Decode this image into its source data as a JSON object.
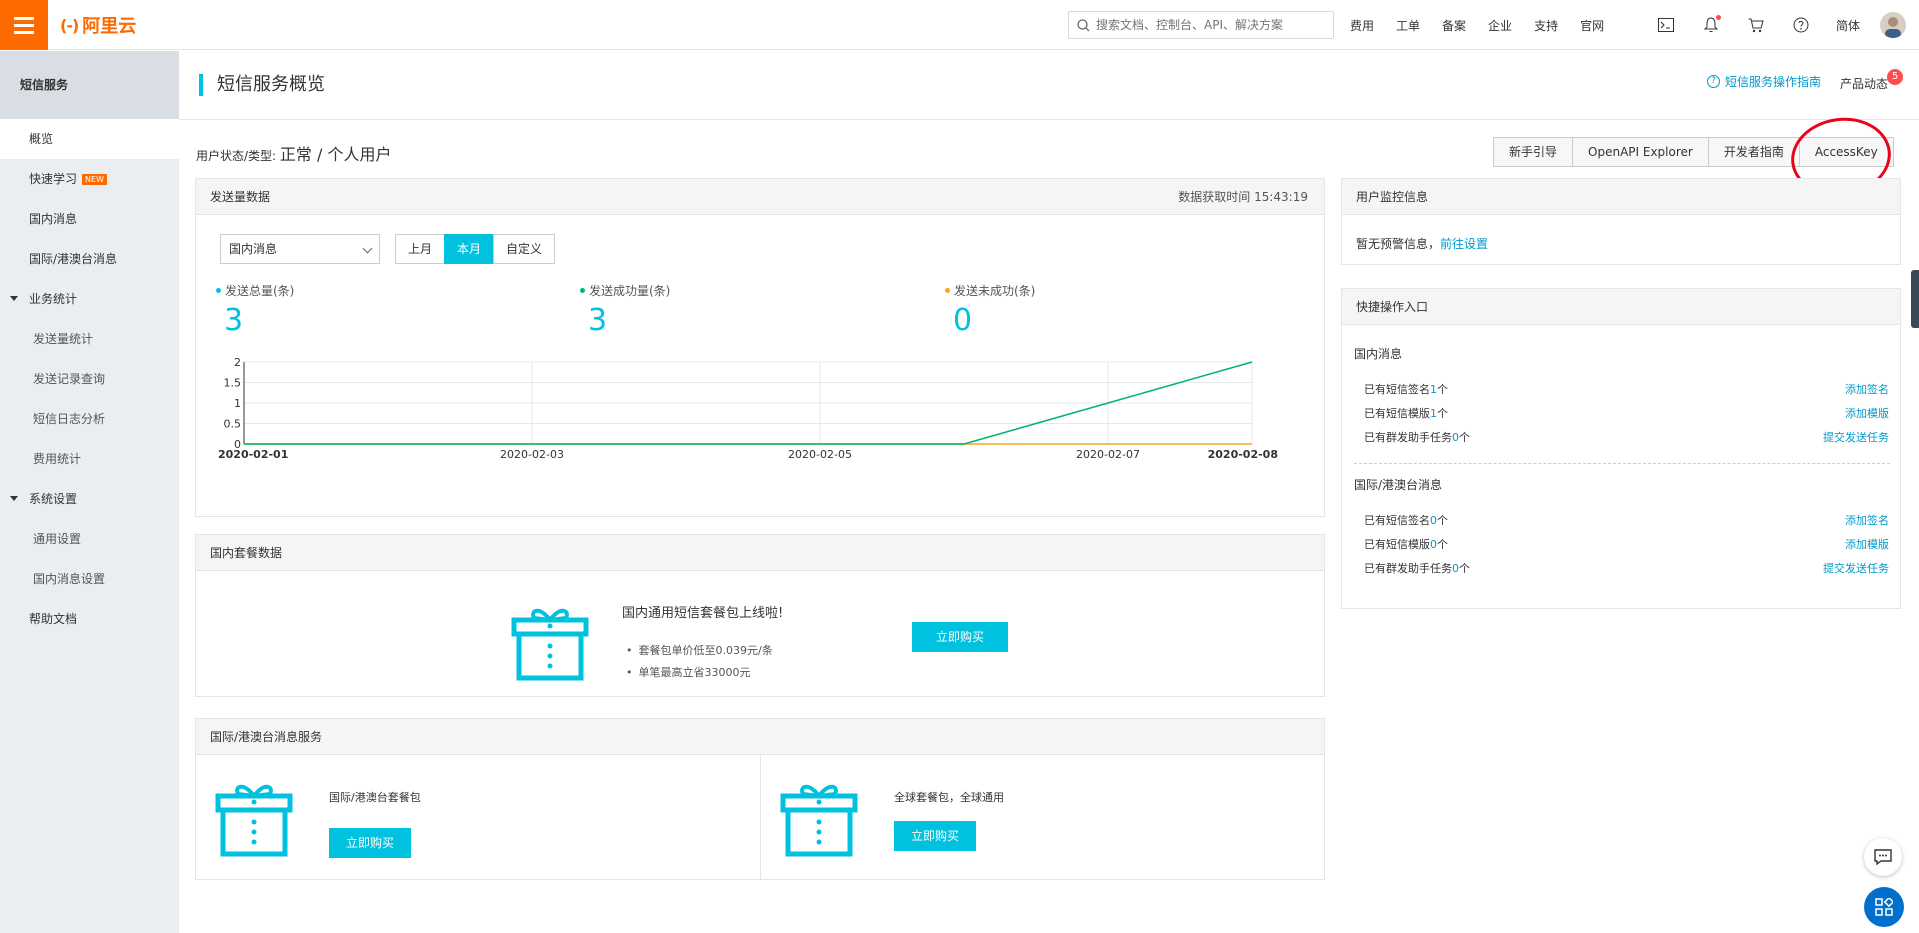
{
  "topbar": {
    "logo_text": "阿里云",
    "logo_mark": "(-)",
    "search_placeholder": "搜索文档、控制台、API、解决方案",
    "links": [
      "费用",
      "工单",
      "备案",
      "企业",
      "支持",
      "官网"
    ],
    "lang": "简体",
    "icons": [
      "terminal-icon",
      "bell-icon",
      "cart-icon",
      "help-icon"
    ]
  },
  "sidebar": {
    "title": "短信服务",
    "items": [
      {
        "label": "概览",
        "active": true
      },
      {
        "label": "快速学习",
        "badge": "NEW"
      },
      {
        "label": "国内消息"
      },
      {
        "label": "国际/港澳台消息"
      },
      {
        "label": "业务统计",
        "group": true
      },
      {
        "label": "发送量统计",
        "sub": true
      },
      {
        "label": "发送记录查询",
        "sub": true
      },
      {
        "label": "短信日志分析",
        "sub": true
      },
      {
        "label": "费用统计",
        "sub": true
      },
      {
        "label": "系统设置",
        "group": true
      },
      {
        "label": "通用设置",
        "sub": true
      },
      {
        "label": "国内消息设置",
        "sub": true
      },
      {
        "label": "帮助文档"
      }
    ]
  },
  "header": {
    "title": "短信服务概览",
    "guide": "短信服务操作指南",
    "news": "产品动态",
    "news_badge": "5"
  },
  "user_status": {
    "label": "用户状态/类型:",
    "value": "正常 / 个人用户"
  },
  "actions": [
    "新手引导",
    "OpenAPI Explorer",
    "开发者指南",
    "AccessKey"
  ],
  "send_card": {
    "title": "发送量数据",
    "time_label": "数据获取时间 15:43:19",
    "select_value": "国内消息",
    "segments": [
      "上月",
      "本月",
      "自定义"
    ],
    "active_segment": "本月",
    "stats": [
      {
        "label": "发送总量(条)",
        "value": "3",
        "color": "#00c1de"
      },
      {
        "label": "发送成功量(条)",
        "value": "3",
        "color": "#00b46e"
      },
      {
        "label": "发送未成功(条)",
        "value": "0",
        "color": "#f5a623"
      }
    ]
  },
  "chart_data": {
    "type": "line",
    "x": [
      "2020-02-01",
      "2020-02-02",
      "2020-02-03",
      "2020-02-04",
      "2020-02-05",
      "2020-02-06",
      "2020-02-07",
      "2020-02-08"
    ],
    "x_ticks": [
      "2020-02-01",
      "2020-02-03",
      "2020-02-05",
      "2020-02-07",
      "2020-02-08"
    ],
    "y_ticks": [
      "0",
      "0.5",
      "1",
      "1.5",
      "2"
    ],
    "ylim": [
      0,
      2
    ],
    "series": [
      {
        "color": "#00b46e",
        "values": [
          0,
          0,
          0,
          0,
          0,
          0,
          1,
          2
        ]
      },
      {
        "color": "#f5a623",
        "values": [
          0,
          0,
          0,
          0,
          0,
          0,
          0,
          0
        ]
      }
    ]
  },
  "pkg_card": {
    "title": "国内套餐数据",
    "headline": "国内通用短信套餐包上线啦!",
    "bullets": [
      "套餐包单价低至0.039元/条",
      "单笔最高立省33000元"
    ],
    "buy": "立即购买"
  },
  "intl_card": {
    "title": "国际/港澳台消息服务",
    "left_text": "国际/港澳台套餐包",
    "right_text": "全球套餐包，全球通用",
    "buy": "立即购买"
  },
  "monitor_card": {
    "title": "用户监控信息",
    "text": "暂无预警信息，",
    "link": "前往设置"
  },
  "quick_card": {
    "title": "快捷操作入口",
    "domestic": {
      "title": "国内消息",
      "rows": [
        {
          "pre": "已有短信签名",
          "count": "1",
          "unit": "个",
          "action": "添加签名"
        },
        {
          "pre": "已有短信模版",
          "count": "1",
          "unit": "个",
          "action": "添加模版"
        },
        {
          "pre": "已有群发助手任务",
          "count": "0",
          "unit": "个",
          "action": "提交发送任务"
        }
      ]
    },
    "intl": {
      "title": "国际/港澳台消息",
      "rows": [
        {
          "pre": "已有短信签名",
          "count": "0",
          "unit": "个",
          "action": "添加签名"
        },
        {
          "pre": "已有短信模版",
          "count": "0",
          "unit": "个",
          "action": "添加模版"
        },
        {
          "pre": "已有群发助手任务",
          "count": "0",
          "unit": "个",
          "action": "提交发送任务"
        }
      ]
    }
  }
}
